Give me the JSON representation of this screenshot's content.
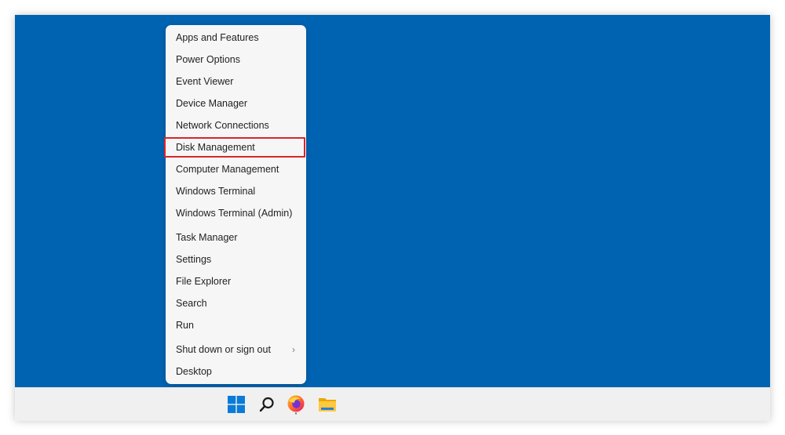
{
  "context_menu": {
    "items": [
      {
        "label": "Apps and Features"
      },
      {
        "label": "Power Options"
      },
      {
        "label": "Event Viewer"
      },
      {
        "label": "Device Manager"
      },
      {
        "label": "Network Connections"
      },
      {
        "label": "Disk Management",
        "highlighted": true
      },
      {
        "label": "Computer Management"
      },
      {
        "label": "Windows Terminal"
      },
      {
        "label": "Windows Terminal (Admin)"
      },
      {
        "label": "Task Manager"
      },
      {
        "label": "Settings"
      },
      {
        "label": "File Explorer"
      },
      {
        "label": "Search"
      },
      {
        "label": "Run"
      },
      {
        "label": "Shut down or sign out",
        "submenu": true,
        "chevron": "›"
      },
      {
        "label": "Desktop"
      }
    ],
    "highlight_color": "#d9252a"
  },
  "desktop": {
    "background_color": "#0063b1"
  },
  "taskbar": {
    "icons": [
      "windows-start-icon",
      "search-icon",
      "firefox-icon",
      "file-explorer-icon"
    ]
  }
}
